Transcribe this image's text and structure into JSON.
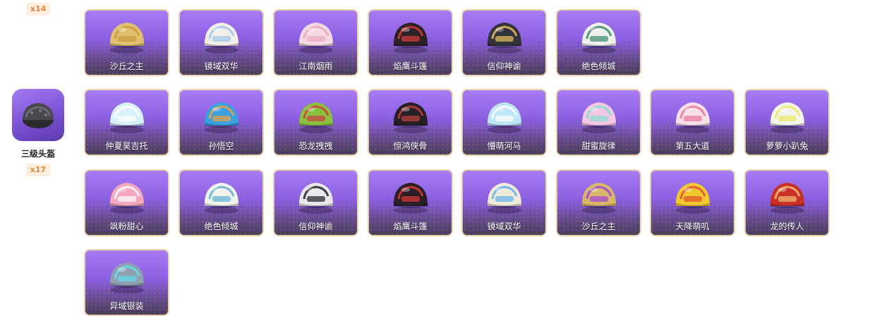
{
  "top_count": "x14",
  "category": {
    "name": "三级头盔",
    "count": "x17",
    "icon": "level3-helmet-icon"
  },
  "skins": [
    {
      "label": "沙丘之主",
      "color": "#e0c070",
      "accent": "#c89a3c"
    },
    {
      "label": "镜域双华",
      "color": "#f2efe8",
      "accent": "#9fc4e8"
    },
    {
      "label": "江南烟雨",
      "color": "#f4d8e4",
      "accent": "#e8a8c0"
    },
    {
      "label": "焰鹰斗篷",
      "color": "#2a2226",
      "accent": "#d83a3a"
    },
    {
      "label": "信仰神谕",
      "color": "#30323c",
      "accent": "#e8c060"
    },
    {
      "label": "绝色倾城",
      "color": "#eef0ea",
      "accent": "#3a8a6a"
    },
    {
      "label": "仲夏昊吉托",
      "color": "#d8f0f8",
      "accent": "#ffffff"
    },
    {
      "label": "孙悟空",
      "color": "#3aa0e0",
      "accent": "#f0a040"
    },
    {
      "label": "恐龙拽拽",
      "color": "#8ac040",
      "accent": "#d04040"
    },
    {
      "label": "惊鸿侠骨",
      "color": "#262026",
      "accent": "#c04040"
    },
    {
      "label": "懵萌河马",
      "color": "#bfe6f4",
      "accent": "#ffffff"
    },
    {
      "label": "甜蜜旋律",
      "color": "#f6c8e4",
      "accent": "#80e0d0"
    },
    {
      "label": "第五大道",
      "color": "#f8e0e8",
      "accent": "#e87898"
    },
    {
      "label": "萝萝小趴兔",
      "color": "#f4f4ee",
      "accent": "#e8e860"
    },
    {
      "label": "飒粉甜心",
      "color": "#f4a8c0",
      "accent": "#ffffff"
    },
    {
      "label": "绝色倾城",
      "color": "#f0f2ee",
      "accent": "#60b0d0"
    },
    {
      "label": "信仰神谕",
      "color": "#e8e8ec",
      "accent": "#202024"
    },
    {
      "label": "焰鹰斗篷",
      "color": "#2a2026",
      "accent": "#e03838"
    },
    {
      "label": "镜域双华",
      "color": "#f0ead8",
      "accent": "#60b0f0"
    },
    {
      "label": "沙丘之主",
      "color": "#d8b868",
      "accent": "#a040e0"
    },
    {
      "label": "天降萌叽",
      "color": "#f4c830",
      "accent": "#e05030"
    },
    {
      "label": "龙的传人",
      "color": "#c83028",
      "accent": "#f0c070"
    },
    {
      "label": "异域银装",
      "color": "#90a0b0",
      "accent": "#60e0f0"
    }
  ]
}
